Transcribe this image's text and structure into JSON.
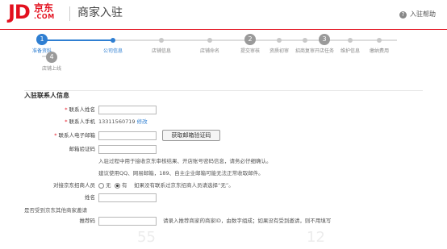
{
  "header": {
    "logo_text": "JD",
    "logo_cn": "京东",
    "logo_com": ".COM",
    "title": "商家入驻",
    "help_label": "入驻帮助",
    "accent": "#e3101e"
  },
  "steps": [
    {
      "num": "1",
      "label": "准备资料",
      "state": "done"
    },
    {
      "num": "",
      "label": "公司信息",
      "state": "current"
    },
    {
      "num": "",
      "label": "店铺信息",
      "state": "todo"
    },
    {
      "num": "",
      "label": "店铺命名",
      "state": "todo"
    },
    {
      "num": "2",
      "label": "提交审核",
      "state": "todo"
    },
    {
      "num": "",
      "label": "资质初审",
      "state": "todo"
    },
    {
      "num": "",
      "label": "招商复审",
      "state": "todo"
    },
    {
      "num": "3",
      "label": "开店任务",
      "state": "todo"
    },
    {
      "num": "",
      "label": "维护信息",
      "state": "todo"
    },
    {
      "num": "",
      "label": "缴纳费用",
      "state": "todo"
    },
    {
      "num": "4",
      "label": "店铺上线",
      "state": "todo"
    }
  ],
  "form": {
    "section_title": "入驻联系人信息",
    "contact_name_label": "联系人姓名",
    "contact_phone_label": "联系人手机",
    "contact_phone_value": "13311560719",
    "modify_link": "修改",
    "contact_email_label": "联系人电子邮箱",
    "email_code_button": "获取邮箱验证码",
    "email_code_label": "邮箱验证码",
    "hint1": "入驻过程中用于接收京东审核结果、开店账号密码信息，请务必仔细确认。",
    "hint2": "建议使用QQ、网易邮箱，189、自主企业邮箱可能无法正常收取邮件。",
    "referrer_label": "对接京东招商人员",
    "radio_no": "无",
    "radio_yes": "有",
    "referrer_hint": "如果没有联系过京东招商人员请选择“无”。",
    "name_label": "姓名",
    "invited_label": "是否受到京东其他商家邀请",
    "recommend_label": "推荐码",
    "recommend_hint": "请录入推荐商家的商家ID，由数字组成；如果没有受到邀请，则不用填写"
  },
  "watermark": {
    "left": "55",
    "right": "12"
  }
}
